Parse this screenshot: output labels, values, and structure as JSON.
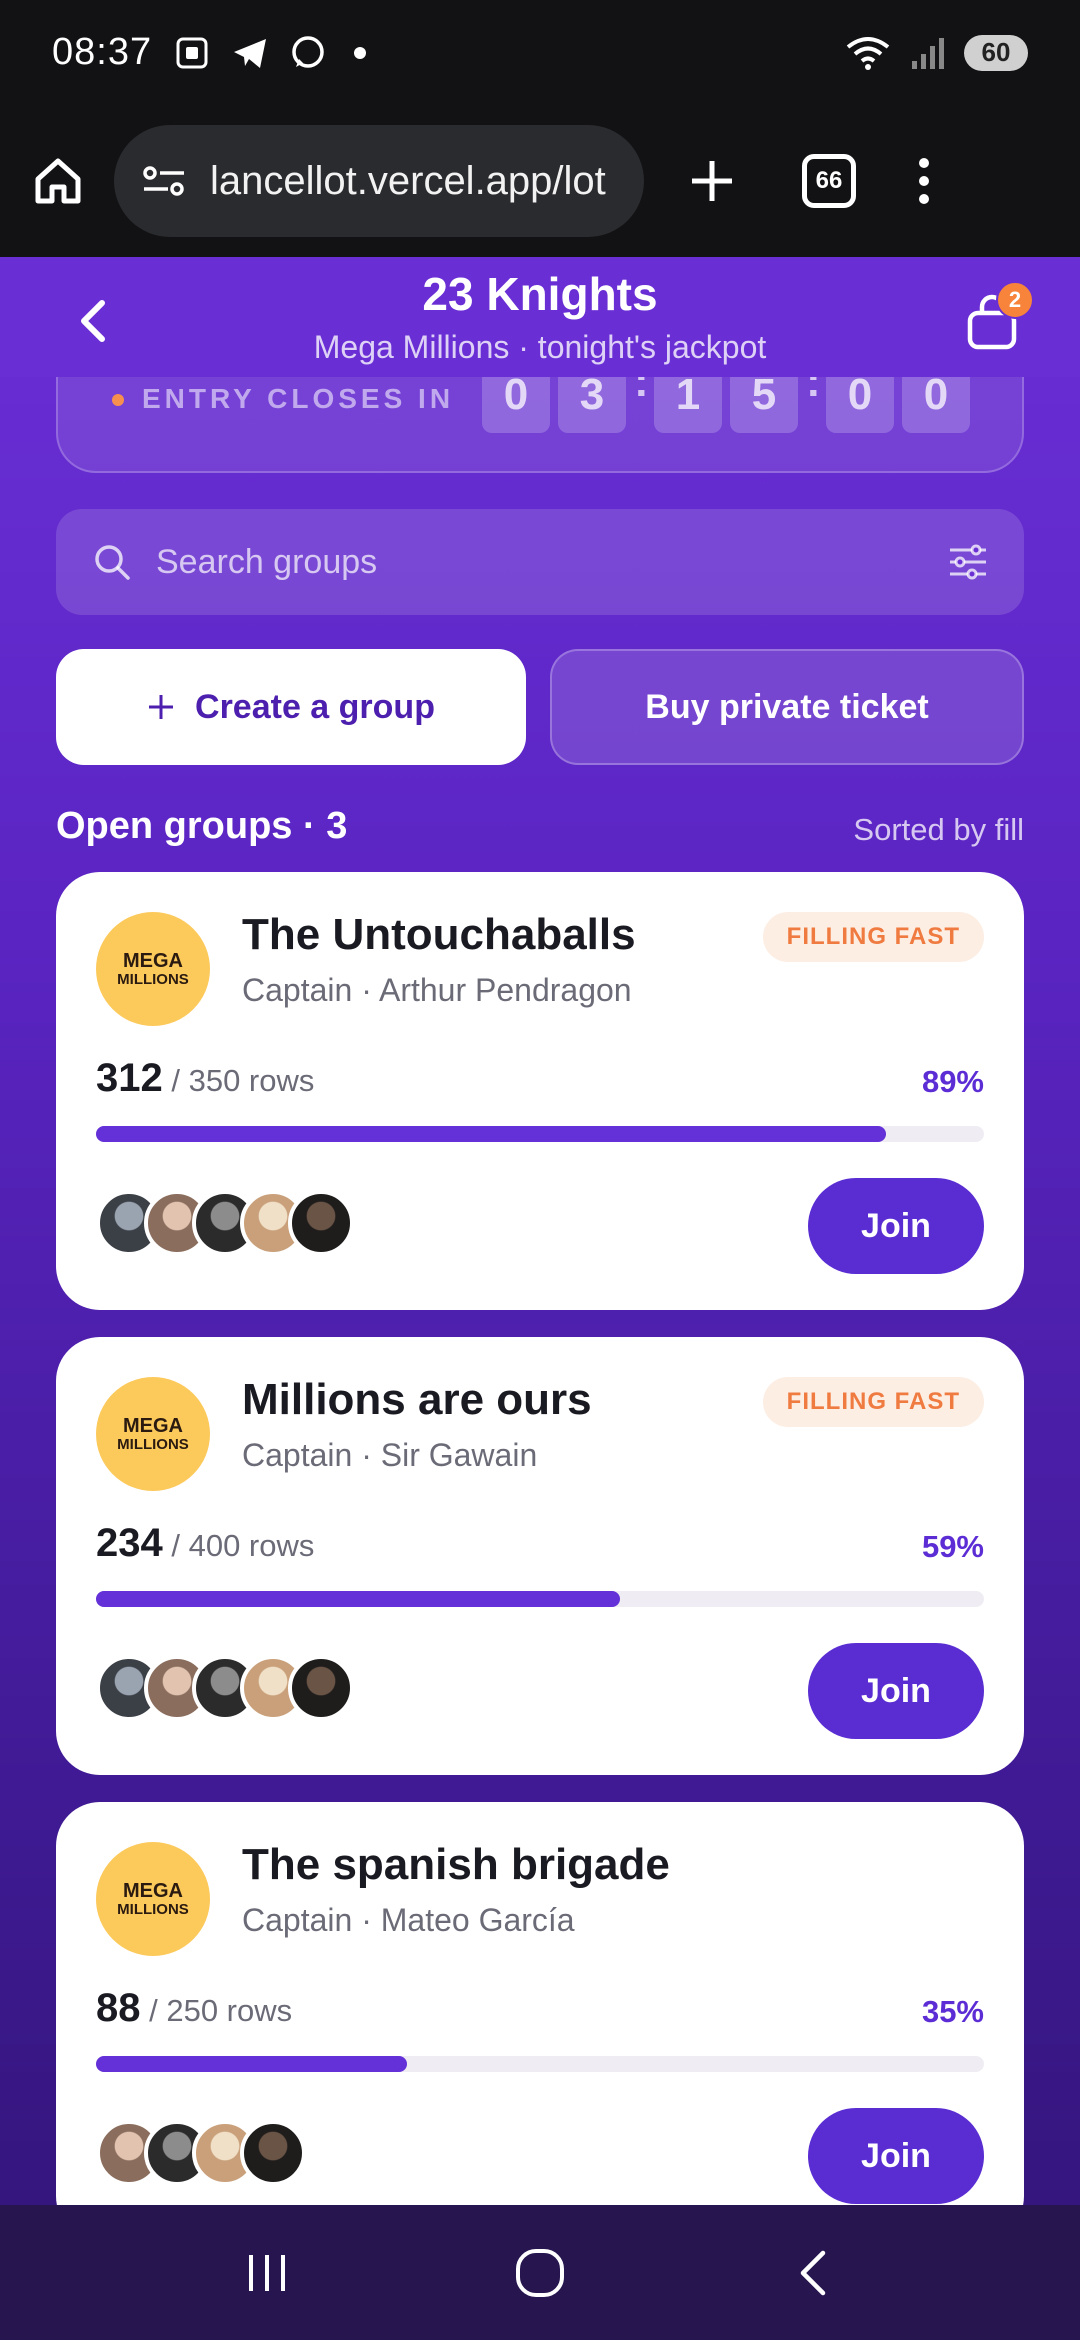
{
  "status": {
    "time": "08:37",
    "battery": "60"
  },
  "browser": {
    "url": "lancellot.vercel.app/lot",
    "tab_count": "66"
  },
  "header": {
    "title": "23 Knights",
    "subtitle": "Mega Millions · tonight's jackpot",
    "cart_count": "2"
  },
  "countdown": {
    "label": "ENTRY CLOSES IN",
    "digits": [
      "0",
      "3",
      "1",
      "5",
      "0",
      "0"
    ],
    "separator": ":"
  },
  "search": {
    "placeholder": "Search groups"
  },
  "actions": {
    "create_label": "Create a group",
    "private_label": "Buy private ticket"
  },
  "section": {
    "title": "Open groups · 3",
    "sort": "Sorted by fill"
  },
  "groups": [
    {
      "logo_line1": "MEGA",
      "logo_line2": "MILLIONS",
      "name": "The Untouchaballs",
      "captain": "Captain · Arthur Pendragon",
      "badge": "FILLING FAST",
      "rows_filled": "312",
      "rows_total": " / 350 rows",
      "percent": "89%",
      "fill": 0.89,
      "join": "Join",
      "avatar_count": 5
    },
    {
      "logo_line1": "MEGA",
      "logo_line2": "MILLIONS",
      "name": "Millions are ours",
      "captain": "Captain · Sir Gawain",
      "badge": "FILLING FAST",
      "rows_filled": "234",
      "rows_total": " / 400 rows",
      "percent": "59%",
      "fill": 0.59,
      "join": "Join",
      "avatar_count": 5
    },
    {
      "logo_line1": "MEGA",
      "logo_line2": "MILLIONS",
      "name": "The spanish brigade",
      "captain": "Captain · Mateo García",
      "badge": "",
      "rows_filled": "88",
      "rows_total": " / 250 rows",
      "percent": "35%",
      "fill": 0.35,
      "join": "Join",
      "avatar_count": 4
    }
  ],
  "colors": {
    "brand_purple": "#6a2ed5",
    "accent_orange": "#f7843a",
    "logo_yellow": "#fcc95b"
  }
}
